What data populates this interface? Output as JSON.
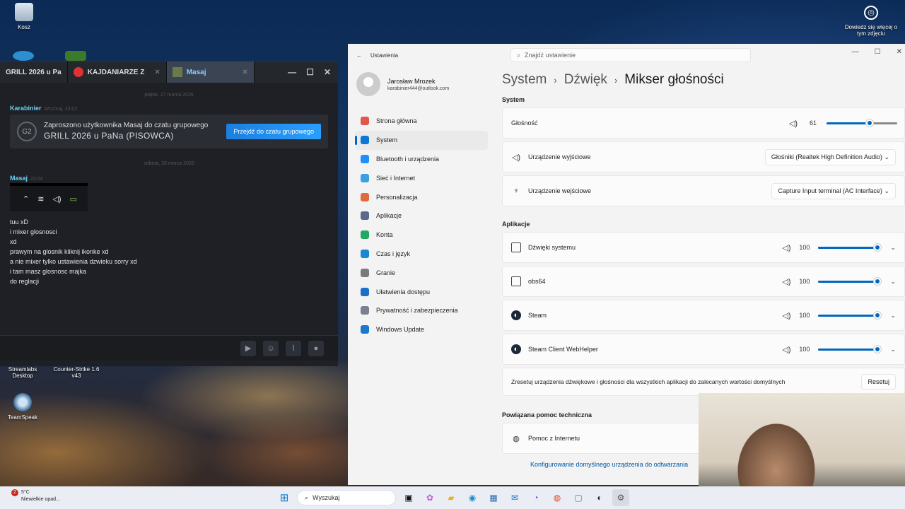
{
  "desktop": {
    "icons": [
      {
        "label": "Kosz"
      },
      {
        "label": "Streamlabs Desktop"
      },
      {
        "label": "Counter-Strike 1.6 v43"
      },
      {
        "label": "TeamSpeak"
      }
    ],
    "info": "Dowiedz się więcej o tym zdjęciu"
  },
  "chat": {
    "tabs": [
      {
        "label": "GRILL 2026 u Pa"
      },
      {
        "label": "KAJDANIARZE Z"
      },
      {
        "label": "Masaj"
      }
    ],
    "date1": "piątek, 27 marca 2026",
    "msg1": {
      "name": "Karabinier",
      "time": "Wczoraj, 23:02",
      "invite_text": "Zaproszono użytkownika Masaj do czatu grupowego",
      "group": "GRILL 2026 u PaNa (PISOWCA)",
      "button": "Przejdź do czatu grupowego",
      "avatar": "G2"
    },
    "date2": "sobota, 28 marca 2026",
    "msg2": {
      "name": "Masaj",
      "time": "22:04",
      "lines": [
        "tuu xD",
        "i mixer glosnosci",
        "xd",
        "prawym na glosnik kliknij ikonke xd",
        "a nie mixer tylko ustawienia dzwieku sorry xd",
        "i tam masz glosnosc majka",
        "do reglacji"
      ]
    }
  },
  "settings": {
    "window_title": "Ustawienia",
    "search_placeholder": "Znajdź ustawienie",
    "user": {
      "name": "Jarosław Mrozek",
      "email": "karabinier444@outlook.com"
    },
    "nav": [
      {
        "label": "Strona główna",
        "icon": "home-icon",
        "color": "#e0574b"
      },
      {
        "label": "System",
        "icon": "system-icon",
        "color": "#0a78d4"
      },
      {
        "label": "Bluetooth i urządzenia",
        "icon": "bluetooth-icon",
        "color": "#1f8fff"
      },
      {
        "label": "Sieć i Internet",
        "icon": "network-icon",
        "color": "#3aa0e0"
      },
      {
        "label": "Personalizacja",
        "icon": "brush-icon",
        "color": "#e06a3a"
      },
      {
        "label": "Aplikacje",
        "icon": "apps-icon",
        "color": "#5a6a8a"
      },
      {
        "label": "Konta",
        "icon": "accounts-icon",
        "color": "#22a864"
      },
      {
        "label": "Czas i język",
        "icon": "globe-icon",
        "color": "#1a88d0"
      },
      {
        "label": "Granie",
        "icon": "gamepad-icon",
        "color": "#7a7a7a"
      },
      {
        "label": "Ułatwienia dostępu",
        "icon": "accessibility-icon",
        "color": "#1a70c8"
      },
      {
        "label": "Prywatność i zabezpieczenia",
        "icon": "shield-icon",
        "color": "#7a8090"
      },
      {
        "label": "Windows Update",
        "icon": "update-icon",
        "color": "#1a78d0"
      }
    ],
    "breadcrumb": [
      "System",
      "Dźwięk",
      "Mikser głośności"
    ],
    "system_section": "System",
    "volume": {
      "label": "Głośność",
      "value": "61",
      "level": 0.61
    },
    "output": {
      "label": "Urządzenie wyjściowe",
      "value": "Głośniki (Realtek High Definition Audio)"
    },
    "input": {
      "label": "Urządzenie wejściowe",
      "value": "Capture Input terminal (AC Interface)"
    },
    "apps_section": "Aplikacje",
    "apps": [
      {
        "label": "Dźwięki systemu",
        "value": "100",
        "level": 1.0
      },
      {
        "label": "obs64",
        "value": "100",
        "level": 1.0
      },
      {
        "label": "Steam",
        "value": "100",
        "level": 1.0
      },
      {
        "label": "Steam Client WebHelper",
        "value": "100",
        "level": 1.0
      }
    ],
    "reset": {
      "text": "Zresetuj urządzenia dźwiękowe i głośności dla wszystkich aplikacji do zalecanych wartości domyślnych",
      "button": "Resetuj"
    },
    "help_section": "Powiązana pomoc techniczna",
    "help_item": "Pomoc z Internetu",
    "help_link": "Konfigurowanie domyślnego urządzenia do odtwarzania"
  },
  "taskbar": {
    "weather_temp": "5°C",
    "weather_desc": "Niewielkie opad...",
    "weather_badge": "2",
    "search": "Wyszukaj"
  }
}
